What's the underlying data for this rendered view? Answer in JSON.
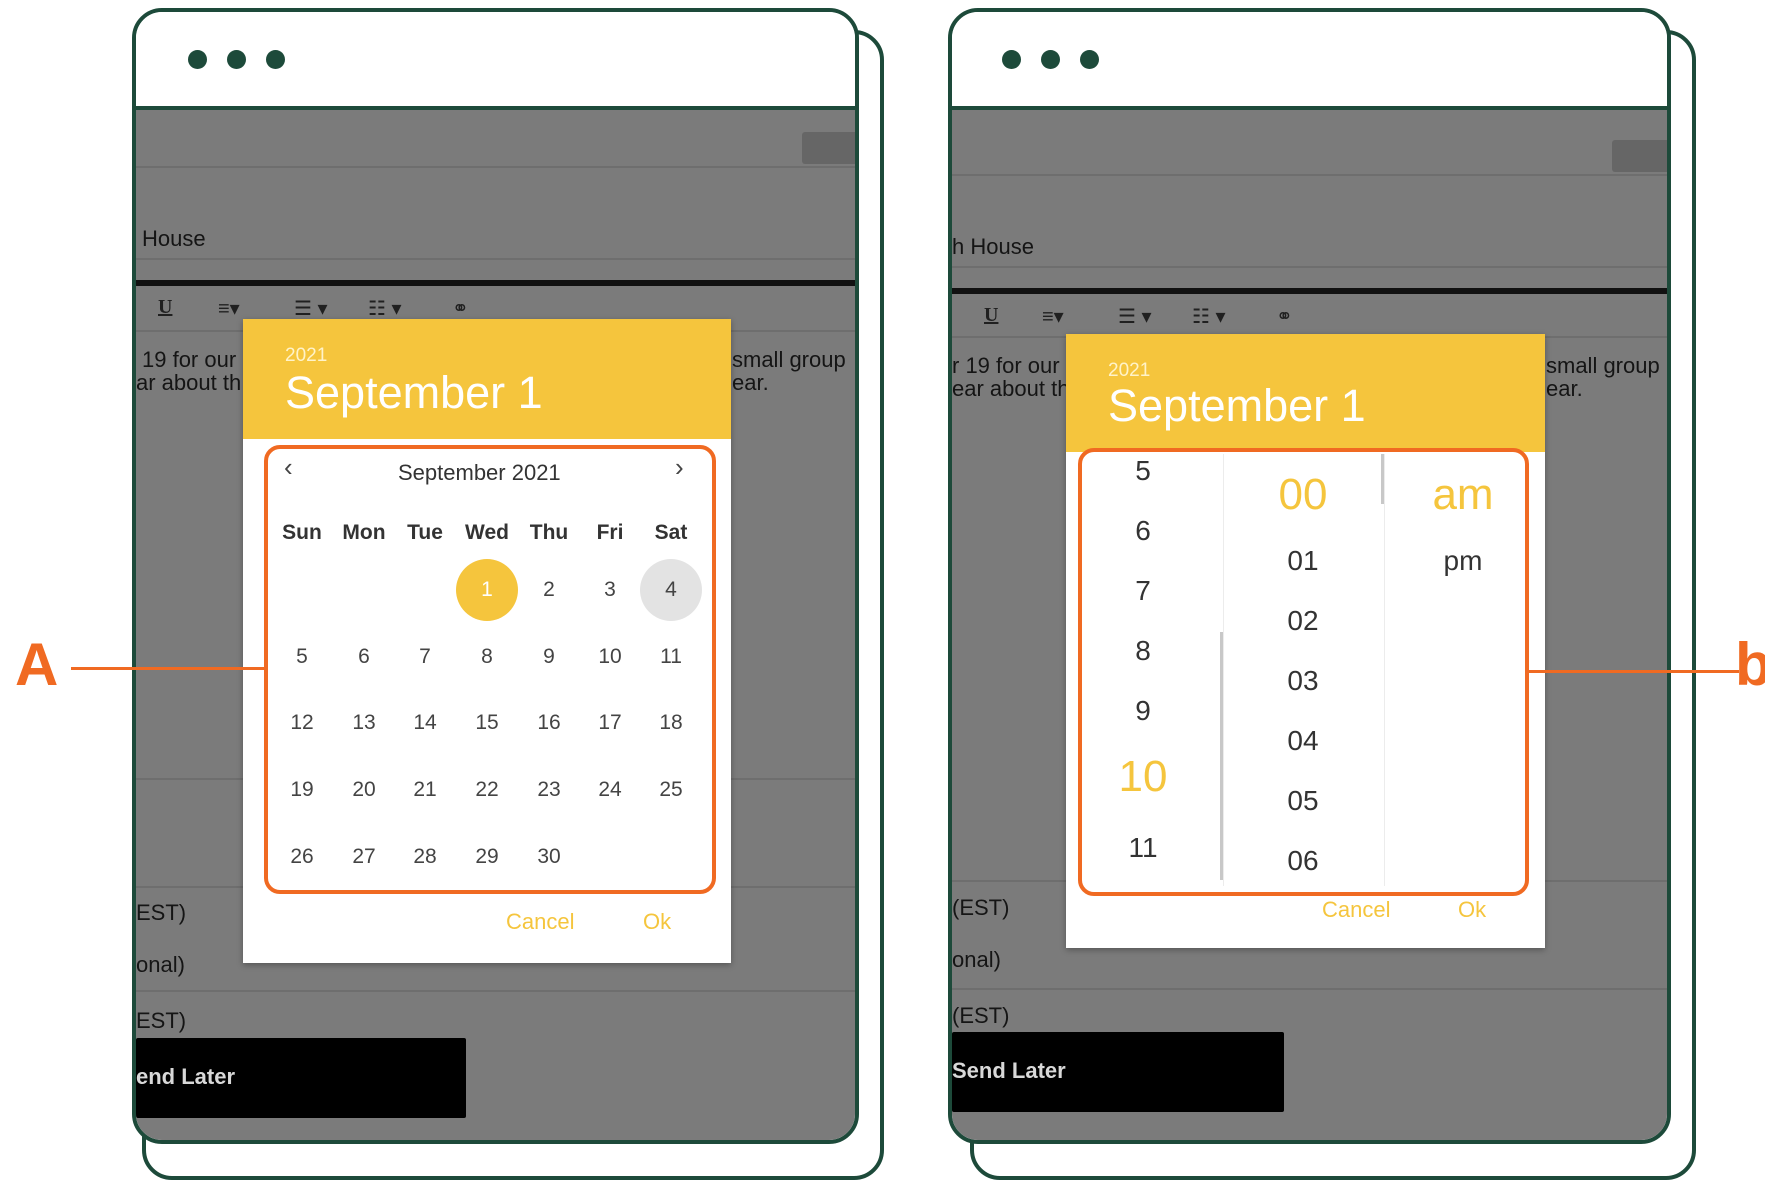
{
  "colors": {
    "frame": "#1d4a3a",
    "accent": "#f5c53d",
    "callout": "#f06a22"
  },
  "callouts": {
    "left": "A",
    "right": "b"
  },
  "background": {
    "text_house_left": "House",
    "text_house_right": "h House",
    "body_line1_left": "19 for our",
    "body_line2_left": "ar about th",
    "body_line1_right": "r 19 for our",
    "body_line2_right": "ear about th",
    "body_right_line1": "small group",
    "body_right_line2": "ear.",
    "est1_left": "EST)",
    "optional_left": "onal)",
    "est2_left": "EST)",
    "est1_right": "(EST)",
    "optional_right": "onal)",
    "est2_right": "(EST)",
    "send_later_left": "end Later",
    "send_later_right": "Send Later",
    "toolbar": {
      "underline": "U",
      "align": "≡▾",
      "bullets": "☰ ▾",
      "numbered": "☷ ▾",
      "link": "⚭"
    }
  },
  "date_picker": {
    "year": "2021",
    "date_title": "September 1",
    "month_label": "September 2021",
    "prev_icon": "‹",
    "next_icon": "›",
    "weekdays": [
      "Sun",
      "Mon",
      "Tue",
      "Wed",
      "Thu",
      "Fri",
      "Sat"
    ],
    "weeks": [
      [
        "",
        "",
        "",
        "1",
        "2",
        "3",
        "4"
      ],
      [
        "5",
        "6",
        "7",
        "8",
        "9",
        "10",
        "11"
      ],
      [
        "12",
        "13",
        "14",
        "15",
        "16",
        "17",
        "18"
      ],
      [
        "19",
        "20",
        "21",
        "22",
        "23",
        "24",
        "25"
      ],
      [
        "26",
        "27",
        "28",
        "29",
        "30",
        "",
        ""
      ]
    ],
    "selected_day": "1",
    "today": "4",
    "cancel_label": "Cancel",
    "ok_label": "Ok"
  },
  "time_picker": {
    "year": "2021",
    "date_title": "September 1",
    "hours": [
      "5",
      "6",
      "7",
      "8",
      "9",
      "10",
      "11"
    ],
    "selected_hour": "10",
    "minutes": [
      "00",
      "01",
      "02",
      "03",
      "04",
      "05",
      "06"
    ],
    "selected_minute": "00",
    "periods": [
      "am",
      "pm"
    ],
    "selected_period": "am",
    "cancel_label": "Cancel",
    "ok_label": "Ok"
  }
}
